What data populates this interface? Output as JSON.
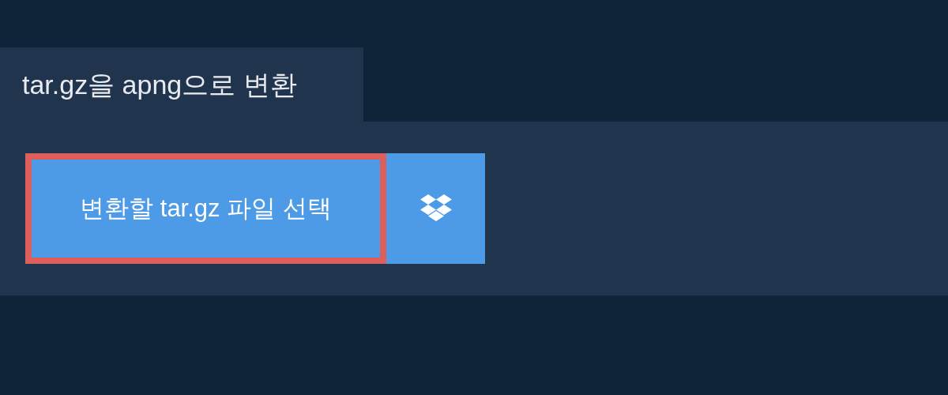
{
  "tab": {
    "label": "tar.gz을 apng으로 변환"
  },
  "upload_button": {
    "label": "변환할 tar.gz 파일 선택",
    "focused": true
  }
}
